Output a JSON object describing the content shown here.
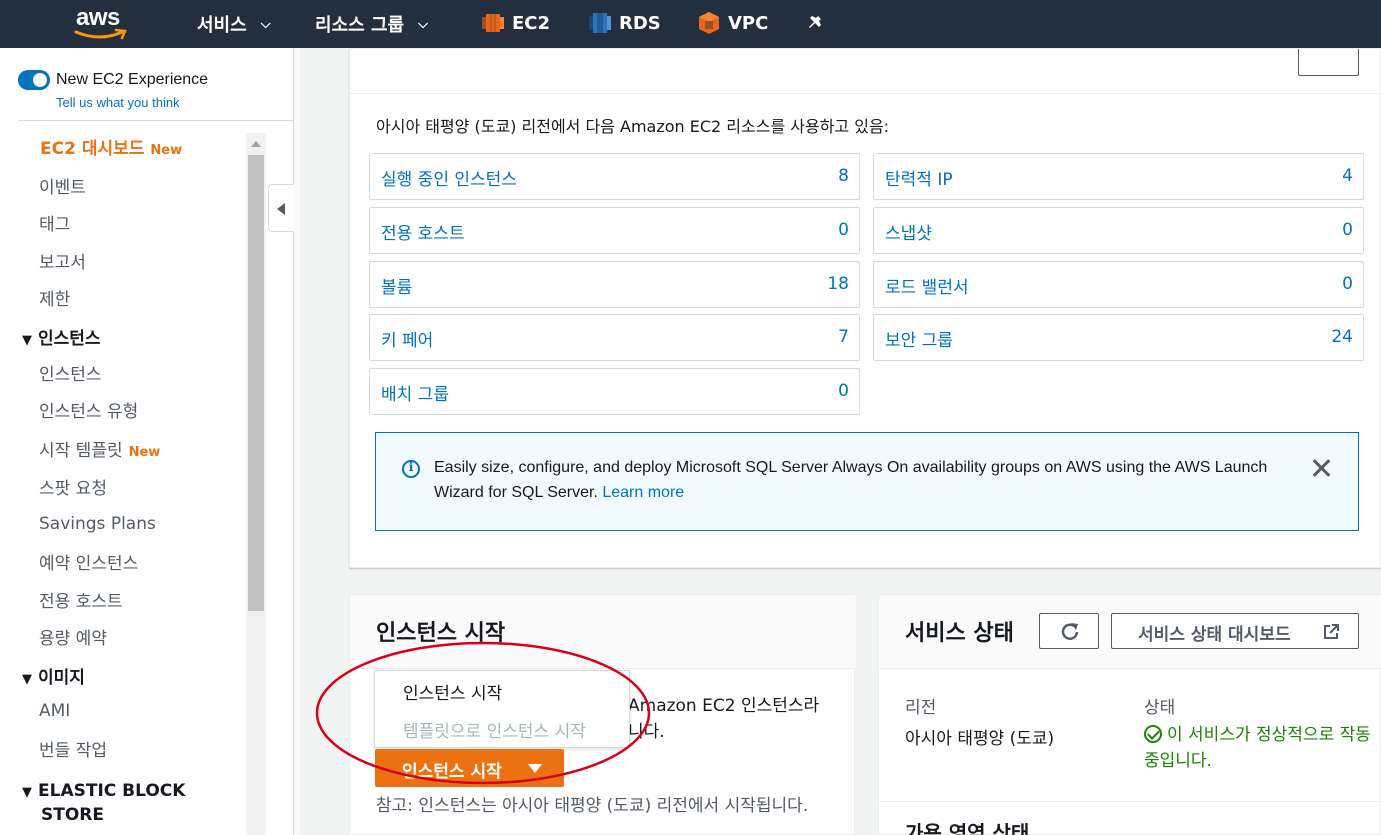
{
  "nav": {
    "logo_text": "aws",
    "services": "서비스",
    "resource_groups": "리소스 그룹",
    "favorites": [
      {
        "label": "EC2",
        "icon": "ec2-icon",
        "color": "#e7661b"
      },
      {
        "label": "RDS",
        "icon": "rds-icon",
        "color": "#2e73b8"
      },
      {
        "label": "VPC",
        "icon": "vpc-icon",
        "color": "#e7661b"
      }
    ]
  },
  "sidebar": {
    "toggle_label": "New EC2 Experience",
    "feedback_link": "Tell us what you think",
    "dashboard": "EC2 대시보드",
    "new_badge": "New",
    "items": {
      "events": "이벤트",
      "tags": "태그",
      "reports": "보고서",
      "limits": "제한"
    },
    "instances_section": "인스턴스",
    "instances_items": {
      "instances": "인스턴스",
      "instance_types": "인스턴스 유형",
      "launch_templates": "시작 템플릿",
      "spot_requests": "스팟 요청",
      "savings_plans": "Savings Plans",
      "reserved_instances": "예약 인스턴스",
      "dedicated_hosts": "전용 호스트",
      "capacity_reservations": "용량 예약"
    },
    "images_section": "이미지",
    "images_items": {
      "ami": "AMI",
      "bundle_tasks": "번들 작업"
    },
    "ebs_section_line1": "ELASTIC BLOCK",
    "ebs_section_line2": "STORE"
  },
  "resources": {
    "intro": "아시아 태평양 (도쿄) 리전에서 다음 Amazon EC2 리소스를 사용하고 있음:",
    "cards": [
      {
        "label": "실행 중인 인스턴스",
        "value": "8"
      },
      {
        "label": "탄력적 IP",
        "value": "4"
      },
      {
        "label": "전용 호스트",
        "value": "0"
      },
      {
        "label": "스냅샷",
        "value": "0"
      },
      {
        "label": "볼륨",
        "value": "18"
      },
      {
        "label": "로드 밸런서",
        "value": "0"
      },
      {
        "label": "키 페어",
        "value": "7"
      },
      {
        "label": "보안 그룹",
        "value": "24"
      },
      {
        "label": "배치 그룹",
        "value": "0"
      }
    ],
    "info_text": "Easily size, configure, and deploy Microsoft SQL Server Always On availability groups on AWS using the AWS Launch Wizard for SQL Server.",
    "info_link": "Learn more"
  },
  "launch": {
    "title": "인스턴스 시작",
    "desc_line1": "Amazon EC2 인스턴스라",
    "desc_line2": "니다.",
    "menu_launch": "인스턴스 시작",
    "menu_template": "템플릿으로 인스턴스 시작",
    "button": "인스턴스 시작",
    "note": "참고: 인스턴스는 아시아 태평양 (도쿄) 리전에서 시작됩니다."
  },
  "health": {
    "title": "서비스 상태",
    "dashboard_button": "서비스 상태 대시보드",
    "region_label": "리전",
    "status_label": "상태",
    "region_value": "아시아 태평양 (도쿄)",
    "status_value": "이 서비스가 정상적으로 작동 중입니다.",
    "sub_title": "가용 영역 상태"
  },
  "colors": {
    "accent": "#ec7211",
    "link": "#0073bb",
    "ok": "#1d8102",
    "annotation": "#d9001b"
  }
}
